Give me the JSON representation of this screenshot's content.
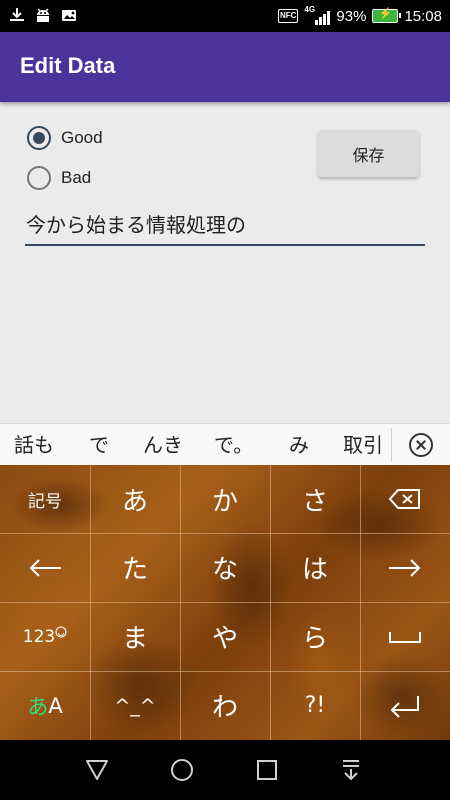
{
  "status_bar": {
    "battery": "93%",
    "time": "15:08",
    "nfc": "NFC",
    "network": "4G",
    "icons": [
      "download-icon",
      "android-icon",
      "image-icon",
      "nfc-icon",
      "signal-icon",
      "battery-charging-icon"
    ]
  },
  "app_bar": {
    "title": "Edit Data"
  },
  "form": {
    "options": [
      {
        "label": "Good",
        "checked": true
      },
      {
        "label": "Bad",
        "checked": false
      }
    ],
    "save_label": "保存",
    "text_value": "今から始まる情報処理の"
  },
  "suggestions": [
    "話も",
    "で",
    "んき",
    "で。",
    "み",
    "取引"
  ],
  "keyboard": {
    "keys": {
      "kigou": "記号",
      "a": "あ",
      "ka": "か",
      "sa": "さ",
      "ta": "た",
      "na": "な",
      "ha": "は",
      "num": "123",
      "ma": "ま",
      "ya": "や",
      "ra": "ら",
      "mode_kana": "あ",
      "mode_alpha": "A",
      "kaomoji": "^_^",
      "wa": "わ",
      "punct": "?!"
    },
    "icons": [
      "backspace-icon",
      "arrow-left-icon",
      "arrow-right-icon",
      "space-icon",
      "enter-icon",
      "smiley-icon"
    ]
  },
  "colors": {
    "app_bar": "#4a349b",
    "accent": "#37495a",
    "background": "#ebebeb",
    "keyboard_theme": "#8a4a10"
  },
  "nav_bar": {
    "icons": [
      "back-icon",
      "home-icon",
      "recents-icon",
      "notification-pull-icon"
    ]
  }
}
